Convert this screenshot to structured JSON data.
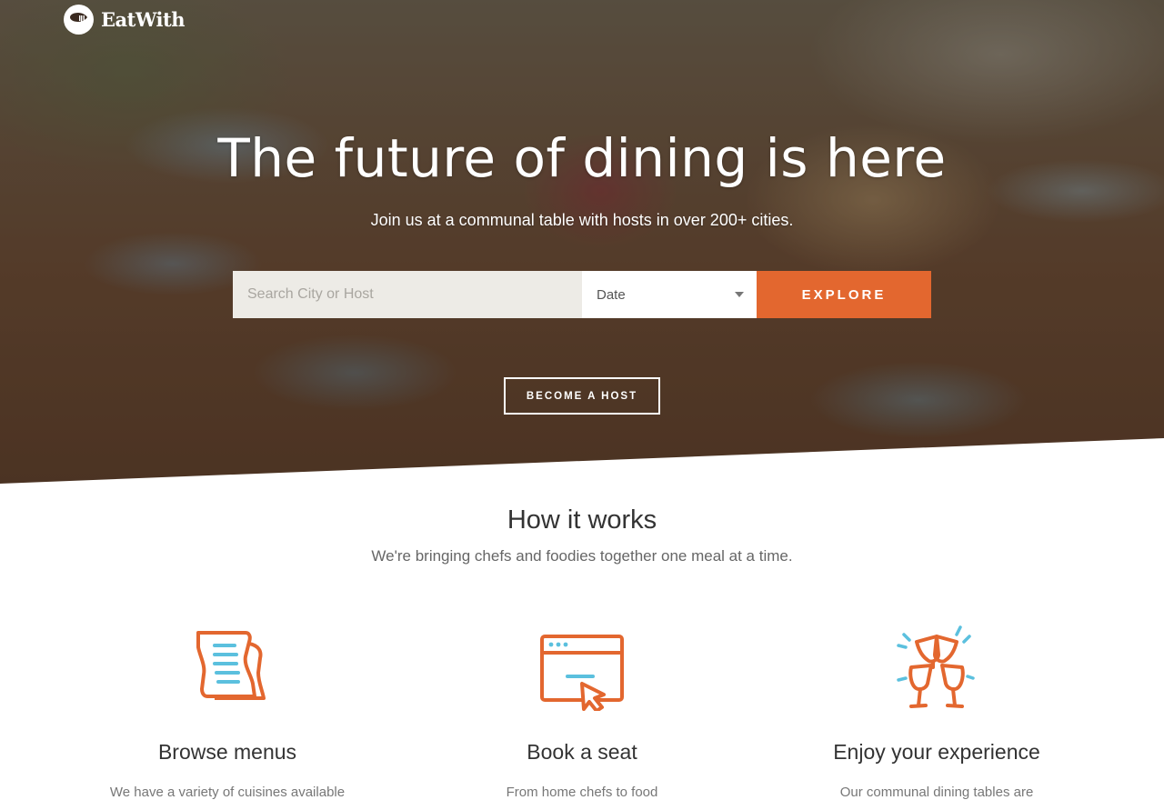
{
  "brand": {
    "name": "EatWith"
  },
  "hero": {
    "title": "The future of dining is here",
    "subtitle": "Join us at a communal table with hosts in over 200+ cities."
  },
  "search": {
    "placeholder": "Search City or Host",
    "date_label": "Date",
    "explore_label": "EXPLORE"
  },
  "host_button": "BECOME A HOST",
  "how": {
    "title": "How it works",
    "subtitle": "We're bringing chefs and foodies together one meal at a time.",
    "steps": [
      {
        "icon": "menu-icon",
        "title": "Browse menus",
        "desc": "We have a variety of cuisines available"
      },
      {
        "icon": "browser-click-icon",
        "title": "Book a seat",
        "desc": "From home chefs to food"
      },
      {
        "icon": "cheers-icon",
        "title": "Enjoy your experience",
        "desc": "Our communal dining tables are"
      }
    ]
  },
  "colors": {
    "accent": "#e3672f",
    "icon_blue": "#5bc0de"
  }
}
